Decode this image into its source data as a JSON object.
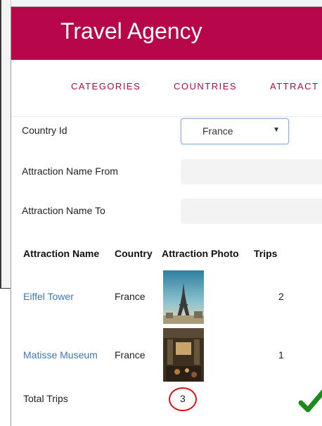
{
  "app": {
    "title": "Travel Agency",
    "brand_color": "#b8064a"
  },
  "nav": {
    "items": [
      {
        "label": "CATEGORIES"
      },
      {
        "label": "COUNTRIES"
      },
      {
        "label": "ATTRACT"
      }
    ]
  },
  "filters": {
    "country_id": {
      "label": "Country Id",
      "value": "France"
    },
    "name_from": {
      "label": "Attraction Name From",
      "value": ""
    },
    "name_to": {
      "label": "Attraction Name To",
      "value": ""
    }
  },
  "grid": {
    "columns": [
      "Attraction Name",
      "Country",
      "Attraction Photo",
      "Trips"
    ],
    "rows": [
      {
        "name": "Eiffel Tower",
        "country": "France",
        "photo_icon": "eiffel-tower-photo",
        "trips": "2"
      },
      {
        "name": "Matisse Museum",
        "country": "France",
        "photo_icon": "museum-photo",
        "trips": "1"
      }
    ]
  },
  "total": {
    "label": "Total Trips",
    "value": "3"
  },
  "annotations": {
    "circle_color": "#e01010",
    "check_icon": "checkmark-icon",
    "check_color": "#1e8a1e"
  }
}
